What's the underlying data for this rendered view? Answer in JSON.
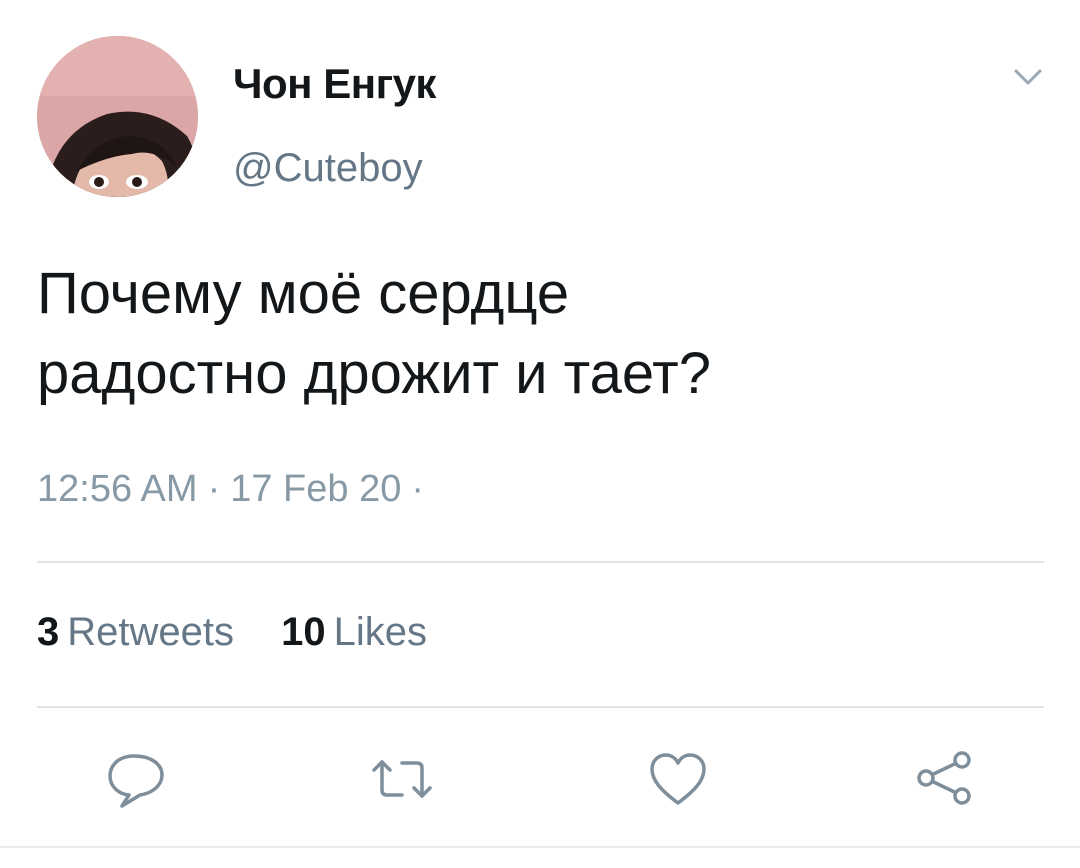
{
  "tweet": {
    "author": {
      "display_name": "Чон Енгук",
      "handle": "@Cuteboy"
    },
    "text_lines": [
      "Почему моё сердце",
      "радостно дрожит и тает?"
    ],
    "time": "12:56 AM",
    "date": "17 Feb 20",
    "separator": "·"
  },
  "stats": {
    "retweets": {
      "count": "3",
      "label": "Retweets"
    },
    "likes": {
      "count": "10",
      "label": "Likes"
    }
  },
  "actions": [
    "reply-icon",
    "retweet-icon",
    "like-icon",
    "share-icon"
  ],
  "colors": {
    "primary_text": "#14171a",
    "secondary_text": "#657786",
    "meta_text": "#8899a6",
    "divider": "#dfe4e8"
  }
}
